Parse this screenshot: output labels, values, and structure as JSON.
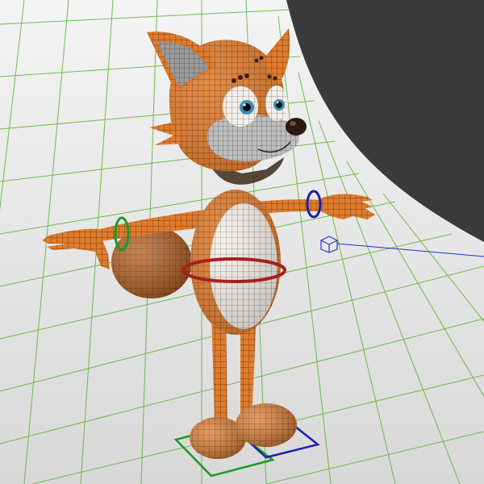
{
  "viewport": {
    "background_color": "#3a3a3a",
    "backdrop_color": "#ececec",
    "grid_color": "#5fb83a",
    "character": {
      "kind": "cartoon fox",
      "skin_color": "#e07b2c",
      "skin_shade_color": "#b85a18",
      "belly_color": "#f3efea",
      "wire_color": "#2b1606"
    },
    "controls": [
      {
        "name": "hip-control",
        "shape": "ring",
        "color": "#a81e1e"
      },
      {
        "name": "left-wrist-control",
        "shape": "ring",
        "color": "#1b9a2a"
      },
      {
        "name": "right-wrist-control",
        "shape": "ring",
        "color": "#1d1dab"
      },
      {
        "name": "left-foot-control",
        "shape": "square",
        "color": "#1b9a2a"
      },
      {
        "name": "right-foot-control",
        "shape": "square",
        "color": "#1d1dab"
      },
      {
        "name": "locator",
        "shape": "cube",
        "color": "#2233cc"
      }
    ]
  }
}
